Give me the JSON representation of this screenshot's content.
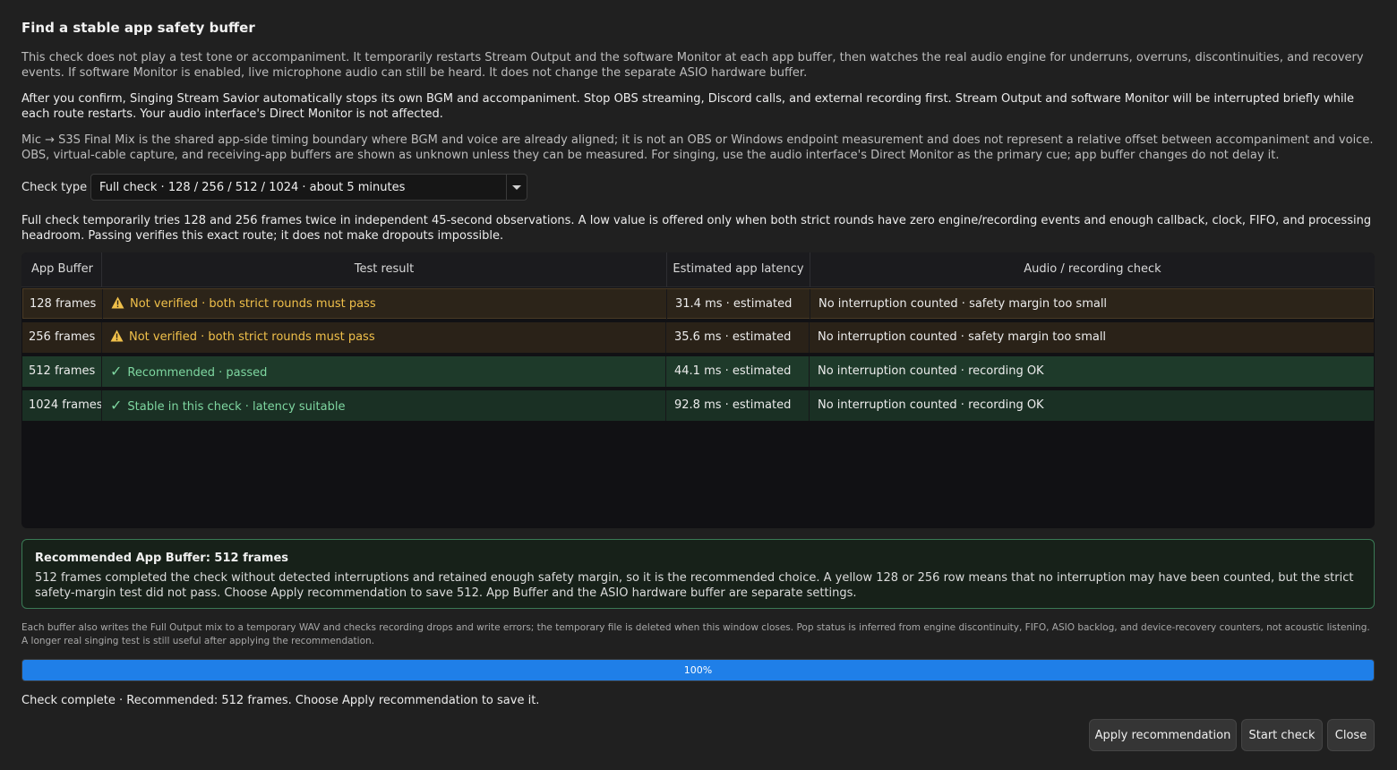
{
  "dialog": {
    "title": "Find a stable app safety buffer",
    "intro": "This check does not play a test tone or accompaniment. It temporarily restarts Stream Output and the software Monitor at each app buffer, then watches the real audio engine for underruns, overruns, discontinuities, and recovery events. If software Monitor is enabled, live microphone audio can still be heard. It does not change the separate ASIO hardware buffer.",
    "confirm_note": "After you confirm, Singing Stream Savior automatically stops its own BGM and accompaniment. Stop OBS streaming, Discord calls, and external recording first. Stream Output and software Monitor will be interrupted briefly while each route restarts. Your audio interface's Direct Monitor is not affected.",
    "boundary_note": "Mic → S3S Final Mix is the shared app-side timing boundary where BGM and voice are already aligned; it is not an OBS or Windows endpoint measurement and does not represent a relative offset between accompaniment and voice. OBS, virtual-cable capture, and receiving-app buffers are shown as unknown unless they can be measured. For singing, use the audio interface's Direct Monitor as the primary cue; app buffer changes do not delay it."
  },
  "check_type": {
    "label": "Check type",
    "selected": "Full check · 128 / 256 / 512 / 1024 · about 5 minutes"
  },
  "check_description": "Full check temporarily tries 128 and 256 frames twice in independent 45-second observations. A low value is offered only when both strict rounds have zero engine/recording events and enough callback, clock, FIFO, and processing headroom. Passing verifies this exact route; it does not make dropouts impossible.",
  "table": {
    "headers": [
      "App Buffer",
      "Test result",
      "Estimated app latency",
      "Audio / recording check"
    ],
    "rows": [
      {
        "buffer": "128 frames",
        "status": "warning",
        "result": "Not verified · both strict rounds must pass",
        "latency": "31.4 ms · estimated",
        "audio": "No interruption counted · safety margin too small"
      },
      {
        "buffer": "256 frames",
        "status": "warning",
        "result": "Not verified · both strict rounds must pass",
        "latency": "35.6 ms · estimated",
        "audio": "No interruption counted · safety margin too small"
      },
      {
        "buffer": "512 frames",
        "status": "recommended",
        "result": "Recommended · passed",
        "latency": "44.1 ms · estimated",
        "audio": "No interruption counted · recording OK"
      },
      {
        "buffer": "1024 frames",
        "status": "ok",
        "result": "Stable in this check · latency suitable",
        "latency": "92.8 ms · estimated",
        "audio": "No interruption counted · recording OK"
      }
    ]
  },
  "recommendation": {
    "heading": "Recommended App Buffer: 512 frames",
    "body": "512 frames completed the check without detected interruptions and retained enough safety margin, so it is the recommended choice. A yellow 128 or 256 row means that no interruption may have been counted, but the strict safety-margin test did not pass. Choose Apply recommendation to save 512. App Buffer and the ASIO hardware buffer are separate settings."
  },
  "footnote": "Each buffer also writes the Full Output mix to a temporary WAV and checks recording drops and write errors; the temporary file is deleted when this window closes. Pop status is inferred from engine discontinuity, FIFO, ASIO backlog, and device-recovery counters, not acoustic listening. A longer real singing test is still useful after applying the recommendation.",
  "progress": {
    "fraction": 1.0,
    "label": "100%"
  },
  "status_text": "Check complete · Recommended: 512 frames. Choose Apply recommendation to save it.",
  "buttons": {
    "apply": "Apply recommendation",
    "start": "Start check",
    "close": "Close"
  },
  "colors": {
    "accent": "#1f7fe8",
    "warning": "#f0c04a",
    "success": "#7ed6a0",
    "recommend_border": "#3a7a55"
  }
}
